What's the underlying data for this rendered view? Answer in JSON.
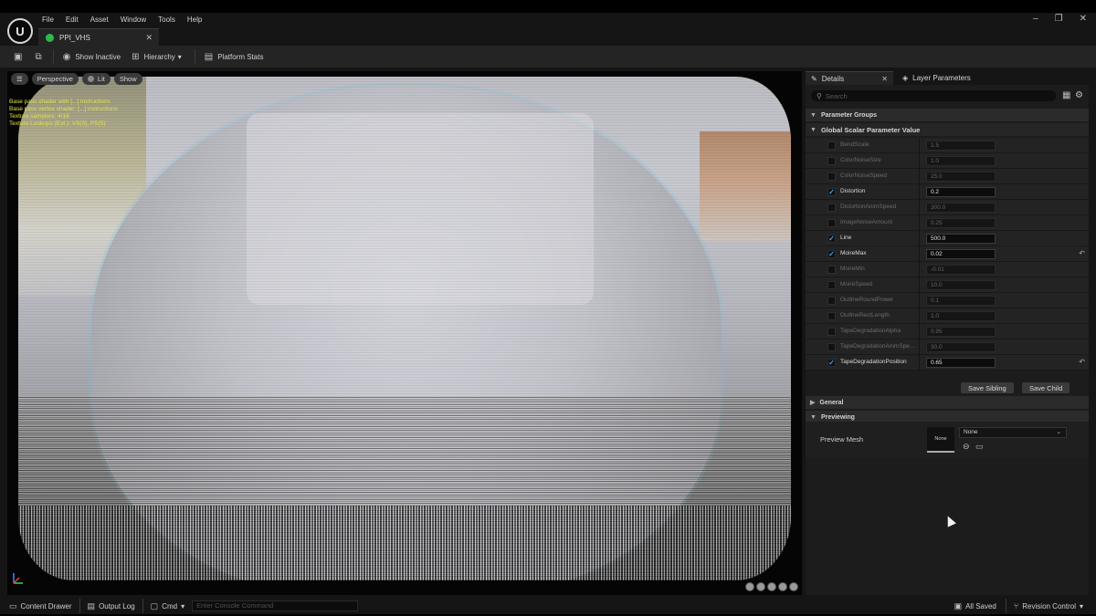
{
  "menubar": {
    "items": [
      "File",
      "Edit",
      "Asset",
      "Window",
      "Tools",
      "Help"
    ],
    "logo": "U"
  },
  "tabs": {
    "active": "PPI_VHS"
  },
  "toolbar": {
    "show_inactive": "Show Inactive",
    "hierarchy": "Hierarchy",
    "platform_stats": "Platform Stats"
  },
  "viewport": {
    "perspective": "Perspective",
    "lit": "Lit",
    "show": "Show",
    "stats": [
      "Base pass shader with [...] instructions",
      "Base pass vertex shader: [...] instructions",
      "Texture samplers: 4/16",
      "Texture Lookups (Est.): VS(3), PS(5)"
    ]
  },
  "details": {
    "tab_details": "Details",
    "tab_layer": "Layer Parameters",
    "search_placeholder": "Search",
    "section_groups": "Parameter Groups",
    "section_global": "Global Scalar Parameter Value",
    "params": [
      {
        "name": "BendScale",
        "value": "1.5",
        "checked": false,
        "reset": false
      },
      {
        "name": "ColorNoiseSize",
        "value": "1.0",
        "checked": false,
        "reset": false
      },
      {
        "name": "ColorNoiseSpeed",
        "value": "25.0",
        "checked": false,
        "reset": false
      },
      {
        "name": "Distortion",
        "value": "0.2",
        "checked": true,
        "reset": false
      },
      {
        "name": "DistortionAnimSpeed",
        "value": "300.0",
        "checked": false,
        "reset": false
      },
      {
        "name": "ImageNoiseAmount",
        "value": "0.25",
        "checked": false,
        "reset": false
      },
      {
        "name": "Line",
        "value": "500.0",
        "checked": true,
        "reset": false
      },
      {
        "name": "MoireMax",
        "value": "0.02",
        "checked": true,
        "reset": true
      },
      {
        "name": "MoireMin",
        "value": "-0.01",
        "checked": false,
        "reset": false
      },
      {
        "name": "MoireSpeed",
        "value": "10.0",
        "checked": false,
        "reset": false
      },
      {
        "name": "OutlineRoundPower",
        "value": "0.1",
        "checked": false,
        "reset": false
      },
      {
        "name": "OutlineRectLength",
        "value": "1.0",
        "checked": false,
        "reset": false
      },
      {
        "name": "TapeDegradationAlpha",
        "value": "0.95",
        "checked": false,
        "reset": false
      },
      {
        "name": "TapeDegradationAnimSpe...",
        "value": "30.0",
        "checked": false,
        "reset": false
      },
      {
        "name": "TapeDegradationPosition",
        "value": "0.65",
        "checked": true,
        "reset": true
      }
    ],
    "save_sibling": "Save Sibling",
    "save_child": "Save Child",
    "section_general": "General",
    "section_previewing": "Previewing",
    "preview_mesh_label": "Preview Mesh",
    "preview_thumb": "None",
    "preview_dropdown": "None"
  },
  "statusbar": {
    "content_drawer": "Content Drawer",
    "output_log": "Output Log",
    "cmd": "Cmd",
    "console_placeholder": "Enter Console Command",
    "all_saved": "All Saved",
    "revision_control": "Revision Control"
  }
}
